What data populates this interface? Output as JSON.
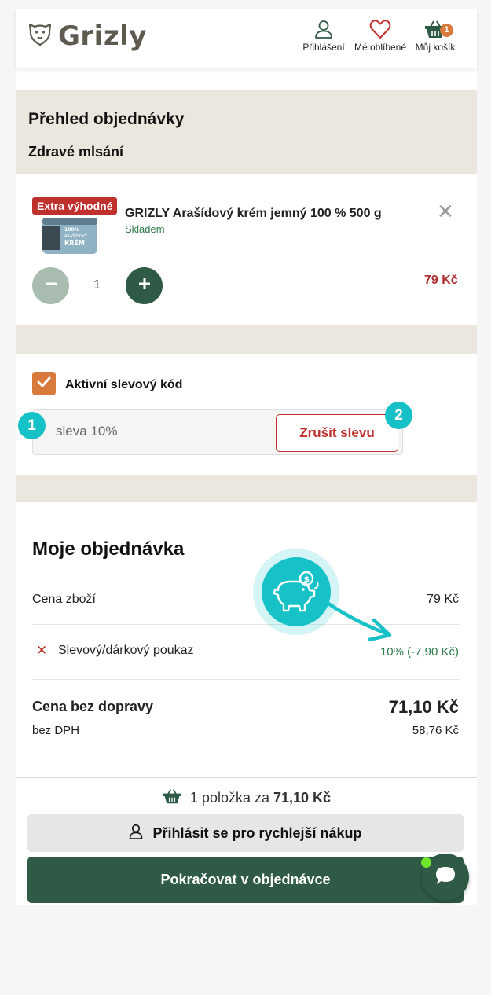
{
  "header": {
    "logo_text": "Grizly",
    "login_label": "Přihlášení",
    "favorites_label": "Mé oblíbené",
    "cart_label": "Můj košík",
    "cart_count": "1"
  },
  "overview": {
    "title": "Přehled objednávky",
    "subtitle": "Zdravé mlsání"
  },
  "product": {
    "badge": "Extra výhodné",
    "name": "GRIZLY Arašídový krém jemný 100 % 500 g",
    "stock": "Skladem",
    "quantity": "1",
    "price": "79 Kč",
    "jar_label_top": "100%",
    "jar_label_mid": "ARAŠÍDOVÝ",
    "jar_label_bottom": "KRÉM"
  },
  "discount": {
    "checkbox_label": "Aktivní slevový kód",
    "checked": true,
    "code_value": "sleva 10%",
    "cancel_label": "Zrušit slevu",
    "marker_1": "1",
    "marker_2": "2"
  },
  "summary": {
    "title": "Moje objednávka",
    "goods_label": "Cena zboží",
    "goods_value": "79 Kč",
    "voucher_label": "Slevový/dárkový poukaz",
    "voucher_value": "10% (-7,90 Kč)",
    "total_label": "Cena bez dopravy",
    "total_value": "71,10 Kč",
    "vat_label": "bez DPH",
    "vat_value": "58,76 Kč"
  },
  "footer": {
    "items_prefix": "1 položka za",
    "items_total": "71,10 Kč",
    "login_button": "Přihlásit se pro rychlejší nákup",
    "continue_button": "Pokračovat v objednávce"
  },
  "colors": {
    "brand_green": "#2f5a45",
    "accent_orange": "#d97a3d",
    "price_red": "#b12d2d",
    "annotation_teal": "#16c2c7",
    "beige": "#ece7de"
  }
}
